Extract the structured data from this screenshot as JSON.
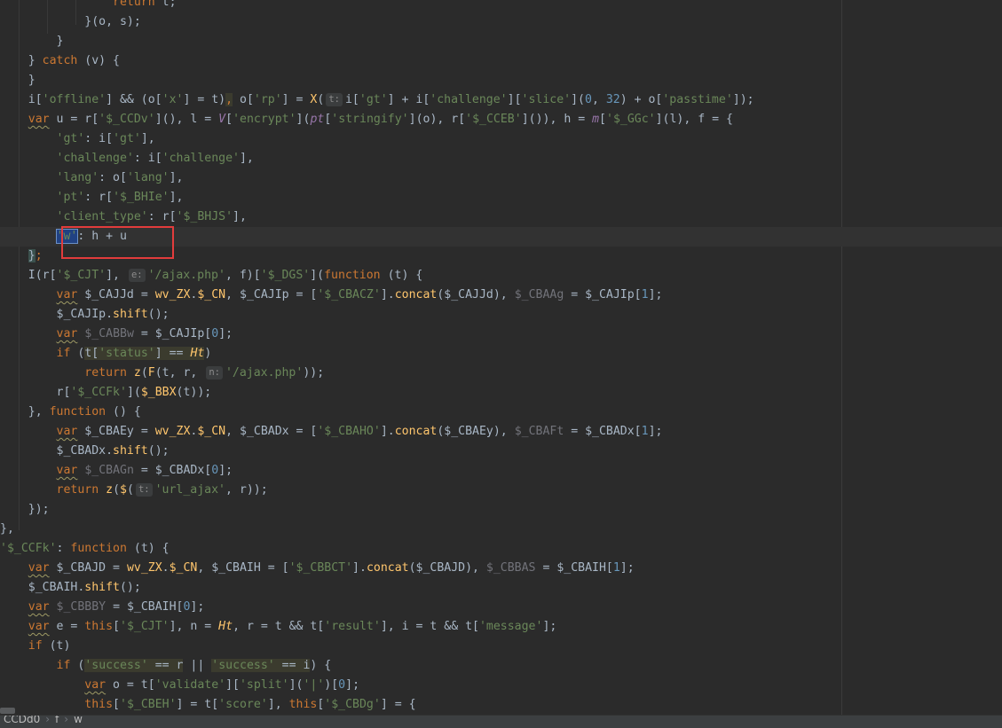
{
  "editor": {
    "hints": {
      "t": "t:",
      "e": "e:",
      "n": "n:"
    },
    "annotation": "highlighted 'w' key"
  },
  "breadcrumb": {
    "items": [
      "CCDd0",
      "f",
      "w"
    ]
  },
  "colors": {
    "background": "#2b2b2b",
    "keyword": "#cc7832",
    "string": "#6a8759",
    "number": "#6897bb",
    "function": "#ffc66d",
    "annotation_border": "#e23c3c",
    "selection": "#214283"
  }
}
